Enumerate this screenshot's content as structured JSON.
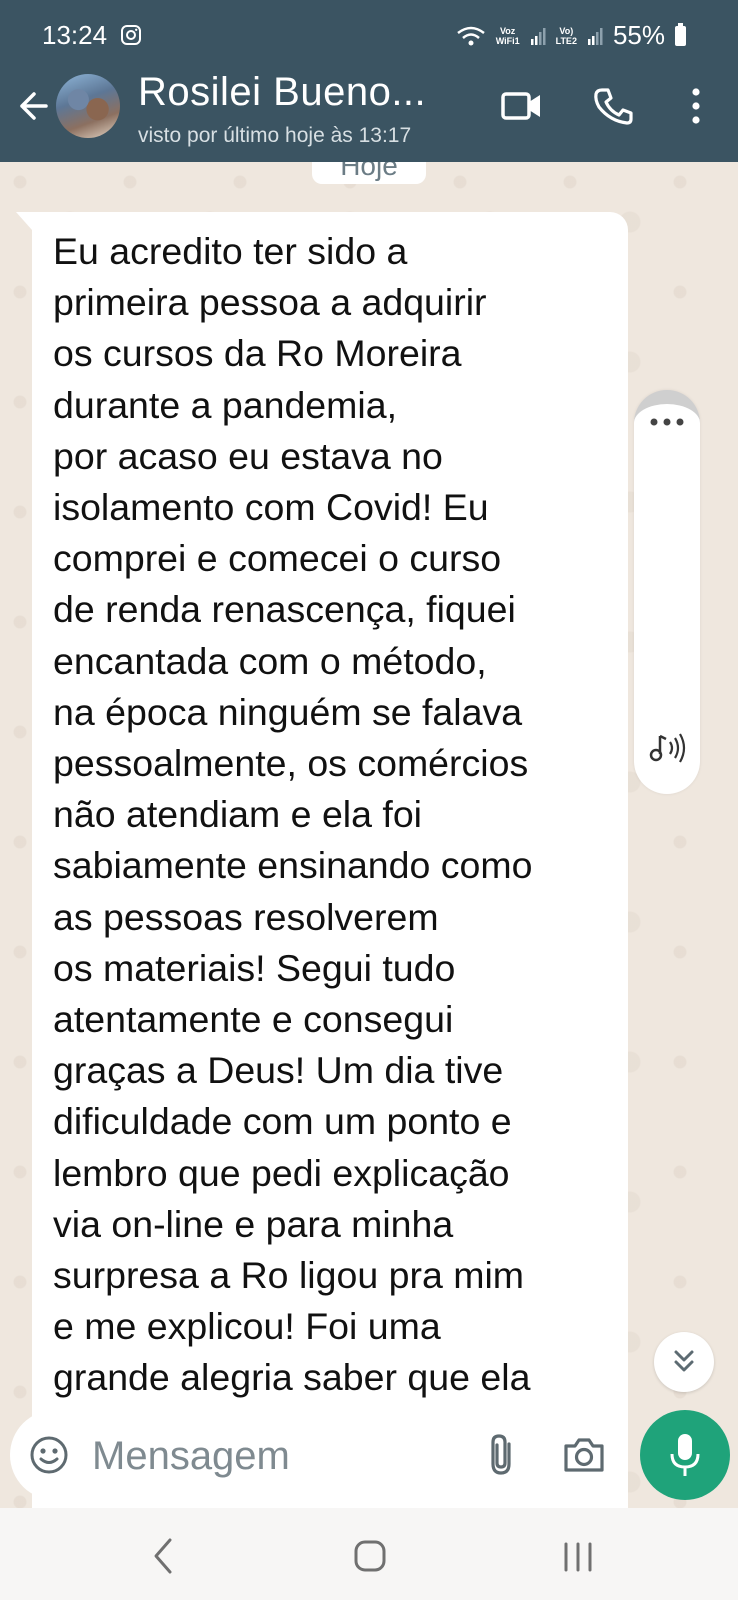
{
  "status_bar": {
    "time": "13:24",
    "wifi_label_top": "Voz",
    "wifi_label_bottom": "WiFi1",
    "lte_label_top": "Vo)",
    "lte_label_bottom": "LTE2",
    "battery": "55%"
  },
  "header": {
    "contact_name": "Rosilei Bueno...",
    "last_seen": "visto por último hoje às 13:17"
  },
  "chat": {
    "date_chip": "Hoje",
    "message": "Eu acredito ter sido a\nprimeira pessoa a adquirir\nos cursos da Ro Moreira\ndurante a pandemia,\npor acaso eu estava no\nisolamento com Covid! Eu\ncomprei e comecei o curso\nde renda renascença, fiquei\nencantada com o método,\nna época ninguém se falava\npessoalmente, os comércios\nnão atendiam e ela foi\nsabiamente ensinando como\nas pessoas resolverem\nos materiais! Segui tudo\natentamente e consegui\ngraças a Deus! Um dia tive\ndificuldade com um ponto e\nlembro que pedi explicação\nvia on-line e para minha\nsurpresa a Ro ligou pra mim\ne me explicou! Foi uma\ngrande alegria saber que ela"
  },
  "input": {
    "placeholder": "Mensagem"
  },
  "colors": {
    "header_bg": "#3b5462",
    "chat_bg": "#efe7de",
    "mic_green": "#1fa37a"
  },
  "icons": [
    "back-arrow-icon",
    "video-call-icon",
    "phone-icon",
    "more-vert-icon",
    "emoji-icon",
    "attach-icon",
    "camera-icon",
    "mic-icon",
    "scroll-down-icon",
    "nav-back-icon",
    "nav-home-icon",
    "nav-recent-icon"
  ]
}
